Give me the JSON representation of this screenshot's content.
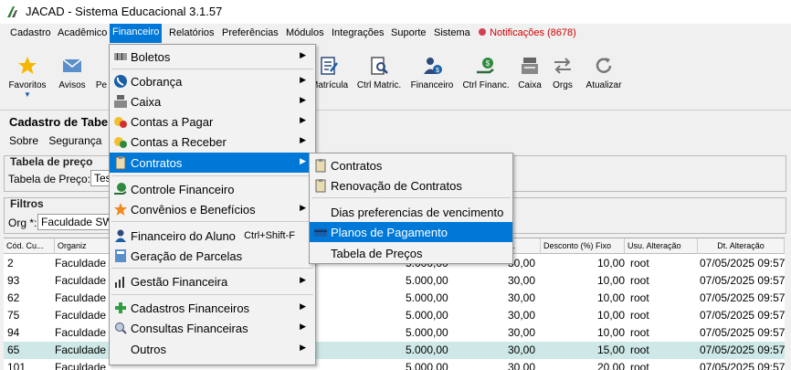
{
  "app": {
    "title": "JACAD - Sistema Educacional 3.1.57"
  },
  "menubar": {
    "items": [
      "Cadastro",
      "Acadêmico",
      "Financeiro",
      "Relatórios",
      "Preferências",
      "Módulos",
      "Integrações",
      "Suporte",
      "Sistema"
    ],
    "notifications": "Notificações (8678)"
  },
  "toolbar": {
    "favoritos": "Favoritos",
    "avisos": "Avisos",
    "pe": "Pe",
    "matricula": "Matrícula",
    "ctrl_matric": "Ctrl Matric.",
    "financeiro": "Financeiro",
    "ctrl_financ": "Ctrl Financ.",
    "caixa": "Caixa",
    "orgs": "Orgs",
    "atualizar": "Atualizar"
  },
  "page": {
    "title": "Cadastro de Tabela",
    "submenu": [
      "Sobre",
      "Segurança"
    ],
    "group_tabela": "Tabela de preço",
    "tabela_label": "Tabela de Preço:",
    "tabela_value": "Tes",
    "group_filtros": "Filtros",
    "org_label": "Org *:",
    "org_value": "Faculdade SW"
  },
  "grid": {
    "headers": [
      "Cód. Cu...",
      "Organiz",
      "x...",
      "Desconto (%) Fixo",
      "Usu. Alteração",
      "Dt. Alteração"
    ],
    "rows": [
      [
        "2",
        "Faculdade",
        "5.000,00",
        "30,00",
        "10,00",
        "root",
        "07/05/2025 09:57"
      ],
      [
        "93",
        "Faculdade",
        "5.000,00",
        "30,00",
        "10,00",
        "root",
        "07/05/2025 09:57"
      ],
      [
        "62",
        "Faculdade",
        "5.000,00",
        "30,00",
        "10,00",
        "root",
        "07/05/2025 09:57"
      ],
      [
        "75",
        "Faculdade",
        "5.000,00",
        "30,00",
        "10,00",
        "root",
        "07/05/2025 09:57"
      ],
      [
        "94",
        "Faculdade",
        "5.000,00",
        "30,00",
        "10,00",
        "root",
        "07/05/2025 09:57"
      ],
      [
        "65",
        "Faculdade",
        "5.000,00",
        "30,00",
        "15,00",
        "root",
        "07/05/2025 09:57"
      ],
      [
        "101",
        "Faculdade",
        "5.000,00",
        "30,00",
        "20,00",
        "root",
        "07/05/2025 09:57"
      ]
    ]
  },
  "financeiro_menu": [
    "Boletos",
    "Cobrança",
    "Caixa",
    "Contas a Pagar",
    "Contas a Receber",
    "Contratos",
    "Controle Financeiro",
    "Convênios e Benefícios",
    "Financeiro do Aluno",
    "Geração de Parcelas",
    "Gestão Financeira",
    "Cadastros Financeiros",
    "Consultas Financeiras",
    "Outros"
  ],
  "financeiro_shortcut": "Ctrl+Shift-F",
  "contratos_menu": [
    "Contratos",
    "Renovação de Contratos",
    "Dias preferencias de vencimento",
    "Planos de Pagamento",
    "Tabela de Preços"
  ]
}
